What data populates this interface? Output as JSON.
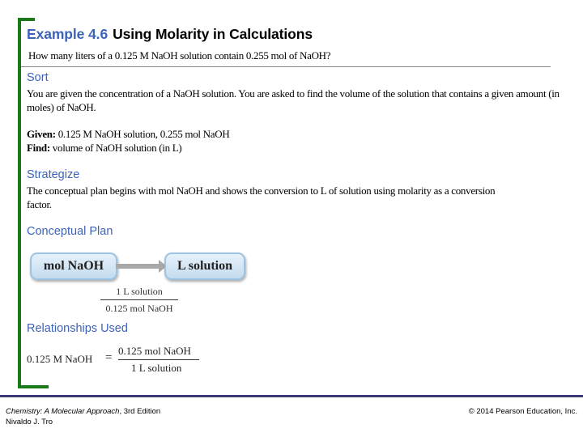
{
  "header": {
    "example_number": "Example 4.6",
    "title": "Using Molarity in Calculations",
    "question": "How many liters of a 0.125 M NaOH solution contain 0.255 mol of NaOH?"
  },
  "sort": {
    "heading": "Sort",
    "text": "You are given the concentration of a NaOH solution. You are asked to find the volume of the solution that contains a given amount (in moles) of NaOH.",
    "given_label": "Given:",
    "given_value": "0.125 M NaOH solution, 0.255 mol NaOH",
    "find_label": "Find:",
    "find_value": "volume of NaOH solution (in L)"
  },
  "strategize": {
    "heading": "Strategize",
    "text": "The conceptual plan begins with mol NaOH and shows the conversion to L of solution using molarity as a conversion factor."
  },
  "conceptual_plan": {
    "heading": "Conceptual Plan",
    "from_box": "mol NaOH",
    "to_box": "L solution",
    "factor_numerator": "1 L solution",
    "factor_denominator": "0.125 mol NaOH"
  },
  "relationships": {
    "heading": "Relationships Used",
    "lhs": "0.125 M NaOH",
    "equals": "=",
    "numerator": "0.125 mol NaOH",
    "denominator": "1 L solution"
  },
  "footer": {
    "book_title": "Chemistry: A Molecular Approach",
    "edition": ", 3rd Edition",
    "author": "Nivaldo J. Tro",
    "copyright": "© 2014 Pearson Education, Inc."
  },
  "colors": {
    "accent_blue": "#3d63b8",
    "bracket_green": "#1a7a1a",
    "footer_bar": "#3a3a78"
  }
}
